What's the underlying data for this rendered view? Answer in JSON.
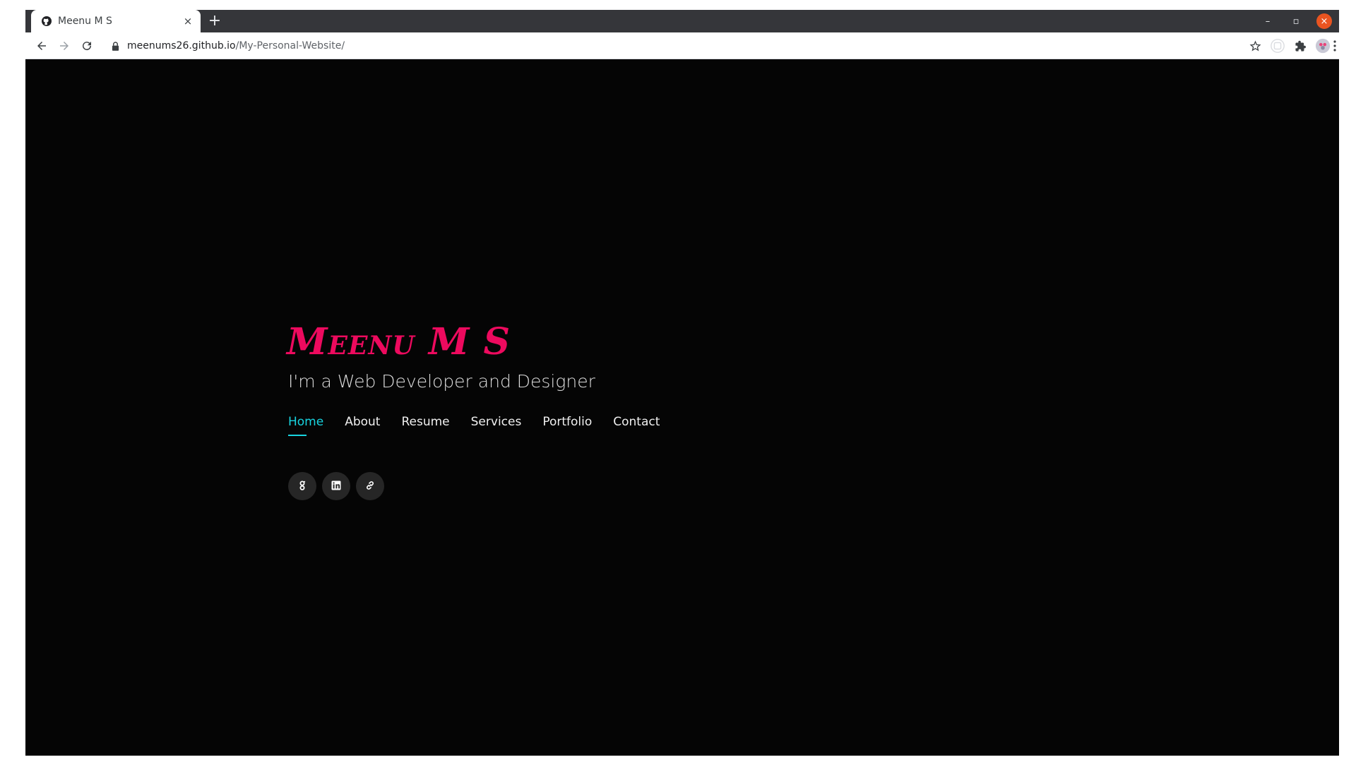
{
  "browser": {
    "tab_title": "Meenu M S",
    "tab_close": "×",
    "new_tab": "+",
    "url_host": "meenums26.github.io",
    "url_path": "/My-Personal-Website/",
    "icons": [
      "github-favicon",
      "back-arrow-icon",
      "forward-arrow-icon",
      "reload-icon",
      "lock-icon",
      "star-icon",
      "extensions-icon",
      "profile-avatar",
      "more-menu-icon"
    ],
    "window_controls": {
      "minimize": "–",
      "restore": "▫",
      "close": "×"
    }
  },
  "hero": {
    "name": "Meenu M S",
    "subtitle": "I'm a Web Developer and Designer",
    "name_color": "#ed0a5e",
    "accent_color": "#18d4e0"
  },
  "nav": {
    "items": [
      {
        "label": "Home",
        "active": true
      },
      {
        "label": "About",
        "active": false
      },
      {
        "label": "Resume",
        "active": false
      },
      {
        "label": "Services",
        "active": false
      },
      {
        "label": "Portfolio",
        "active": false
      },
      {
        "label": "Contact",
        "active": false
      }
    ]
  },
  "social": {
    "items": [
      {
        "icon": "github-icon"
      },
      {
        "icon": "linkedin-icon"
      },
      {
        "icon": "link-icon"
      }
    ]
  }
}
